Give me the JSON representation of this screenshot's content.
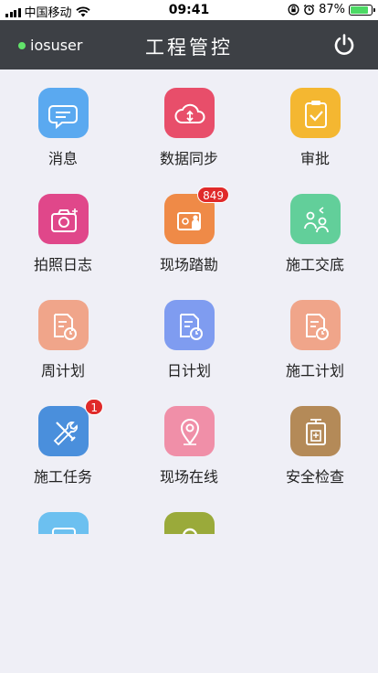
{
  "status_bar": {
    "carrier": "中国移动",
    "time": "09:41",
    "battery": "87%",
    "battery_level": 0.87
  },
  "header": {
    "username": "iosuser",
    "title": "工程管控",
    "power_icon": "power-icon"
  },
  "tiles": [
    {
      "label": "消息",
      "icon": "message-icon",
      "color": "#5aa9f0"
    },
    {
      "label": "数据同步",
      "icon": "cloud-sync-icon",
      "color": "#e84e6a"
    },
    {
      "label": "审批",
      "icon": "clipboard-check-icon",
      "color": "#f4b731"
    },
    {
      "label": "拍照日志",
      "icon": "camera-icon",
      "color": "#e0478a"
    },
    {
      "label": "现场踏勘",
      "icon": "survey-icon",
      "color": "#ef8a47",
      "badge": "849"
    },
    {
      "label": "施工交底",
      "icon": "handover-icon",
      "color": "#62cf9a"
    },
    {
      "label": "周计划",
      "icon": "weekly-plan-icon",
      "color": "#f0a58a"
    },
    {
      "label": "日计划",
      "icon": "daily-plan-icon",
      "color": "#7f9cf0"
    },
    {
      "label": "施工计划",
      "icon": "construction-plan-icon",
      "color": "#f0a58a"
    },
    {
      "label": "施工任务",
      "icon": "tools-icon",
      "color": "#4a8fdc",
      "badge": "1"
    },
    {
      "label": "现场在线",
      "icon": "location-pin-icon",
      "color": "#f08fa8"
    },
    {
      "label": "安全检查",
      "icon": "safety-check-icon",
      "color": "#b48a58"
    },
    {
      "label": "",
      "icon": "bus-icon",
      "color": "#6cc0f0"
    },
    {
      "label": "",
      "icon": "search-icon",
      "color": "#9aaa3a"
    }
  ]
}
